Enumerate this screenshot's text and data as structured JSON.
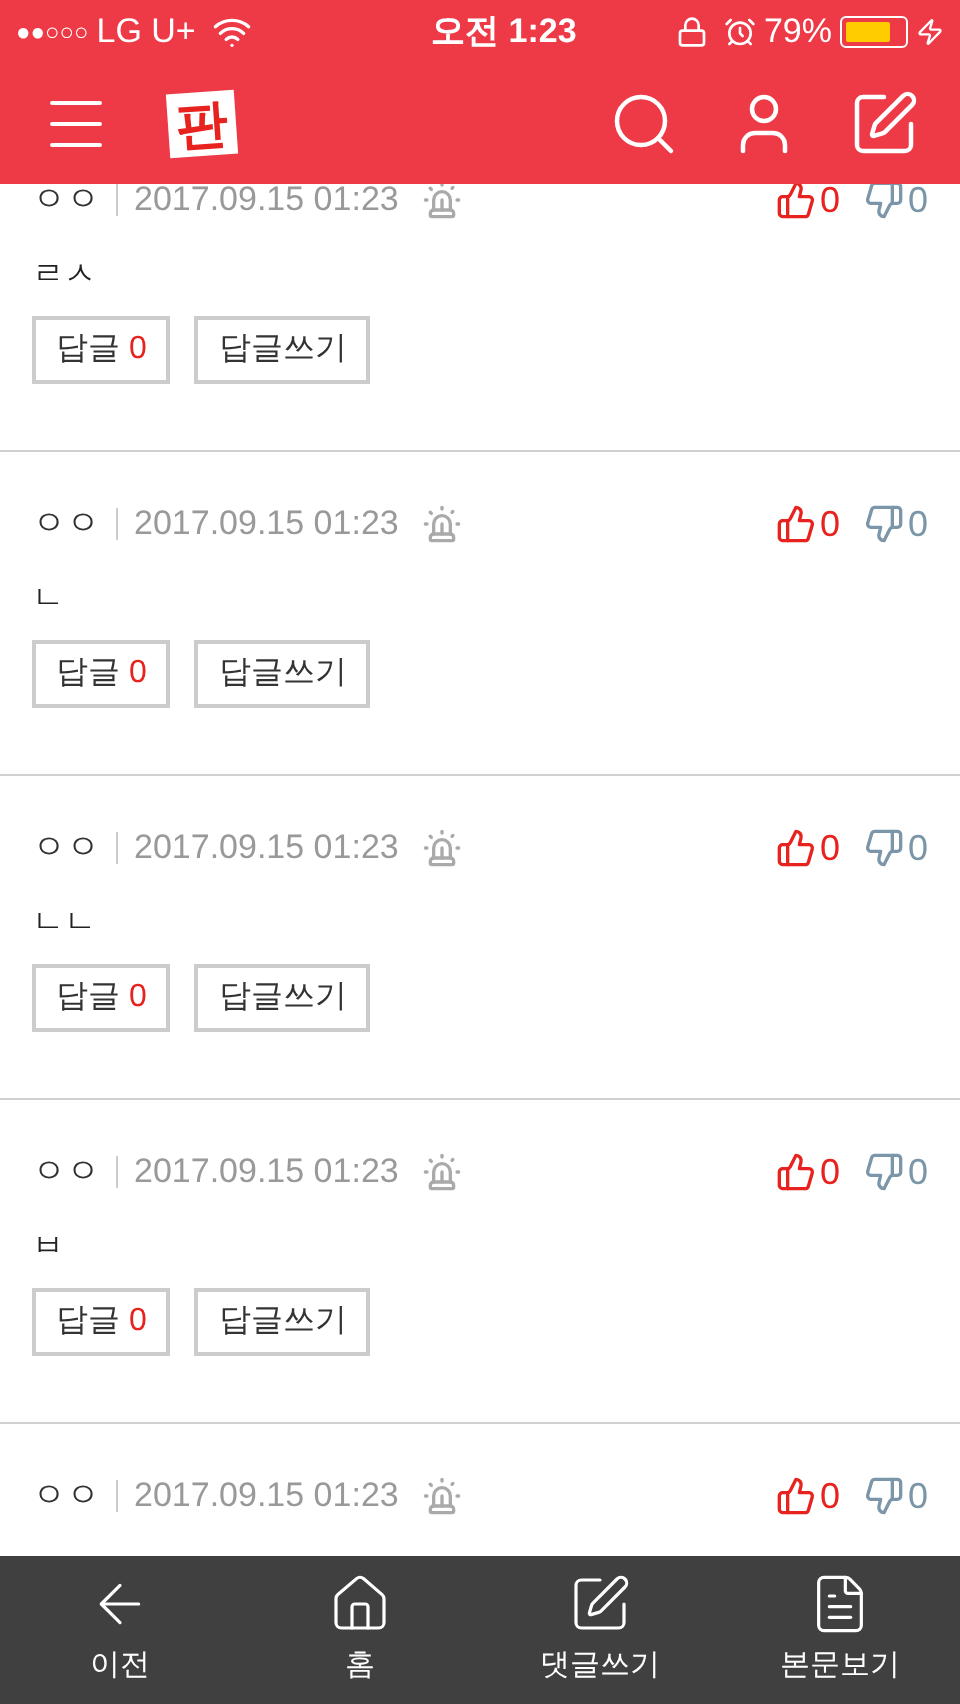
{
  "status_bar": {
    "signal_dots": "●●○○○",
    "carrier": "LG U+",
    "time": "오전 1:23",
    "battery_percent": "79%"
  },
  "header": {
    "logo": "판"
  },
  "comments": [
    {
      "author": "ㅇㅇ",
      "date": "2017.09.15 01:23",
      "likes": "0",
      "dislikes": "0",
      "body": "ㄹㅅ",
      "reply_label": "답글",
      "reply_count": "0",
      "write_reply": "답글쓰기"
    },
    {
      "author": "ㅇㅇ",
      "date": "2017.09.15 01:23",
      "likes": "0",
      "dislikes": "0",
      "body": "ㄴ",
      "reply_label": "답글",
      "reply_count": "0",
      "write_reply": "답글쓰기"
    },
    {
      "author": "ㅇㅇ",
      "date": "2017.09.15 01:23",
      "likes": "0",
      "dislikes": "0",
      "body": "ㄴㄴ",
      "reply_label": "답글",
      "reply_count": "0",
      "write_reply": "답글쓰기"
    },
    {
      "author": "ㅇㅇ",
      "date": "2017.09.15 01:23",
      "likes": "0",
      "dislikes": "0",
      "body": "ㅂ",
      "reply_label": "답글",
      "reply_count": "0",
      "write_reply": "답글쓰기"
    },
    {
      "author": "ㅇㅇ",
      "date": "2017.09.15 01:23",
      "likes": "0",
      "dislikes": "0"
    }
  ],
  "bottom_nav": [
    {
      "kind": "back",
      "label": "이전"
    },
    {
      "kind": "home",
      "label": "홈"
    },
    {
      "kind": "comment",
      "label": "댓글쓰기"
    },
    {
      "kind": "article",
      "label": "본문보기"
    }
  ]
}
